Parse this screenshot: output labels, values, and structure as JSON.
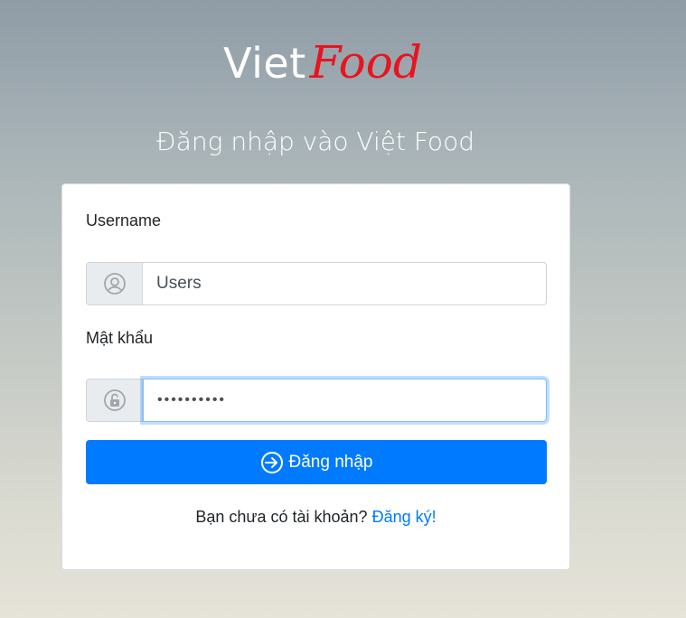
{
  "logo": {
    "part1": "Viet",
    "part2": "Food"
  },
  "subtitle": "Đăng nhập vào Việt Food",
  "form": {
    "username_label": "Username",
    "username_value": "Users",
    "password_label": "Mật khẩu",
    "password_value": "••••••••••",
    "submit_label": "Đăng nhập"
  },
  "footer": {
    "prompt": "Bạn chưa có tài khoản?",
    "register_link": "Đăng ký!"
  },
  "colors": {
    "primary": "#007bff",
    "logo_accent": "#e8141f"
  },
  "icons": {
    "username": "user-circle-icon",
    "password": "lock-icon",
    "submit": "sign-in-icon"
  }
}
